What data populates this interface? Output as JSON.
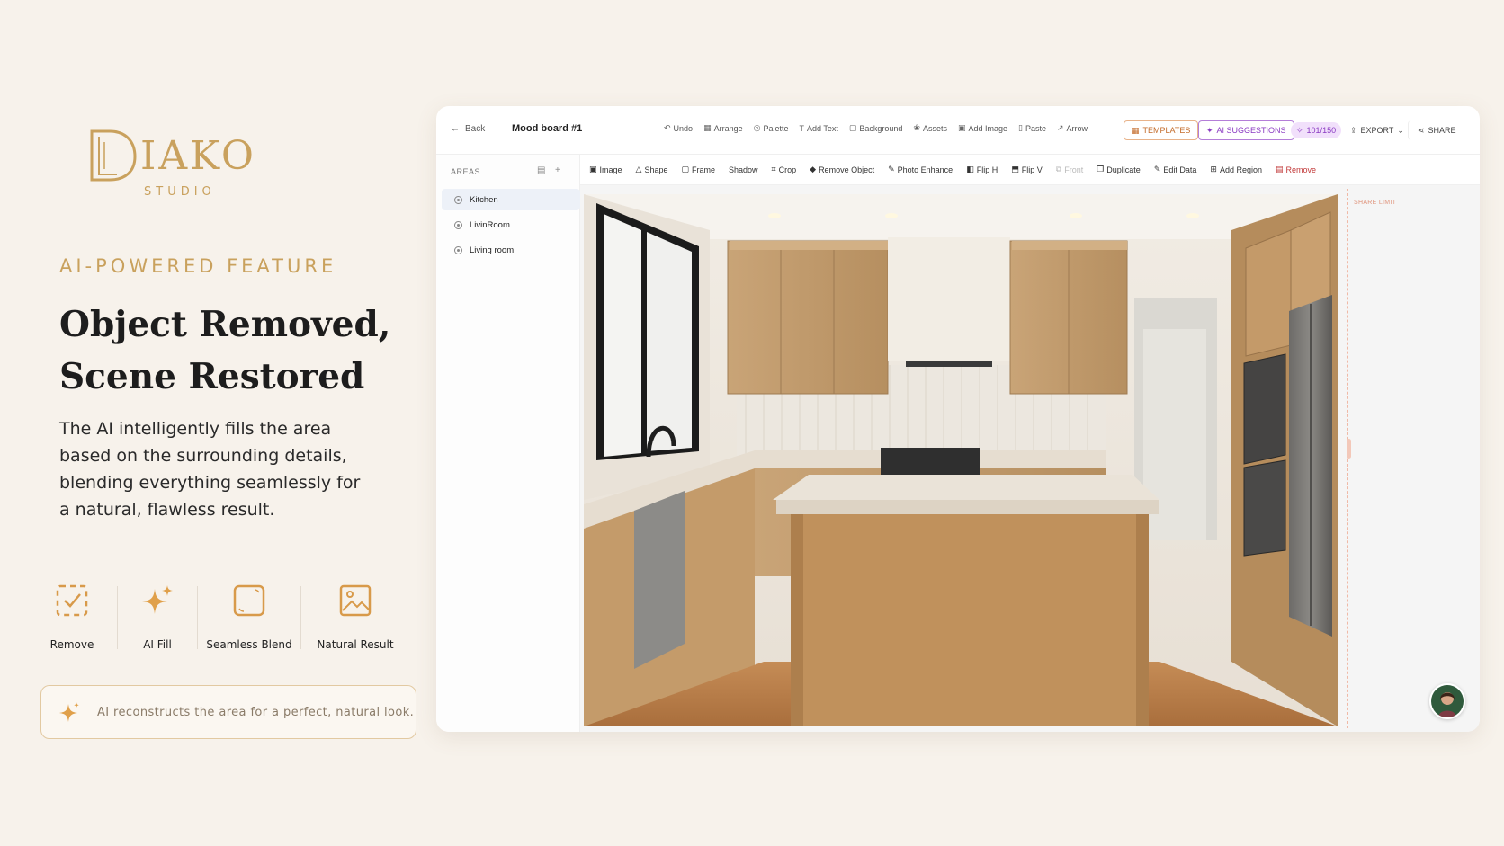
{
  "brand": {
    "name": "IAKO",
    "sub": "STUDIO",
    "accent": "#c9a15d"
  },
  "promo": {
    "tag": "AI-POWERED FEATURE",
    "headline_lines": [
      "Object Removed,",
      "Scene Restored"
    ],
    "description": "The AI intelligently fills the area based on the surrounding details, blending everything seamlessly for a natural, flawless result.",
    "features": [
      {
        "icon": "remove-check-icon",
        "label": "Remove"
      },
      {
        "icon": "sparkle-icon",
        "label": "AI Fill"
      },
      {
        "icon": "blend-square-icon",
        "label": "Seamless Blend"
      },
      {
        "icon": "image-icon",
        "label": "Natural Result"
      }
    ],
    "hint": "AI reconstructs the area for a perfect, natural look."
  },
  "app": {
    "back_label": "Back",
    "doc_title": "Mood board #1",
    "toolbar": [
      {
        "icon": "undo-icon",
        "label": "Undo"
      },
      {
        "icon": "arrange-icon",
        "label": "Arrange"
      },
      {
        "icon": "palette-icon",
        "label": "Palette"
      },
      {
        "icon": "text-icon",
        "label": "Add Text"
      },
      {
        "icon": "background-icon",
        "label": "Background"
      },
      {
        "icon": "assets-icon",
        "label": "Assets"
      },
      {
        "icon": "add-image-icon",
        "label": "Add Image"
      },
      {
        "icon": "paste-icon",
        "label": "Paste"
      },
      {
        "icon": "arrow-icon",
        "label": "Arrow"
      }
    ],
    "templates_label": "TEMPLATES",
    "ai_suggestions_label": "AI SUGGESTIONS",
    "credits": "101/150",
    "export_label": "EXPORT",
    "share_label": "SHARE",
    "areas_label": "AREAS",
    "areas": [
      {
        "label": "Kitchen",
        "selected": true
      },
      {
        "label": "LivinRoom",
        "selected": false
      },
      {
        "label": "Living room",
        "selected": false
      }
    ],
    "subtools": [
      {
        "icon": "image-icon",
        "label": "Image",
        "state": "normal"
      },
      {
        "icon": "shape-icon",
        "label": "Shape",
        "state": "normal"
      },
      {
        "icon": "frame-icon",
        "label": "Frame",
        "state": "normal"
      },
      {
        "icon": "shadow-icon",
        "label": "Shadow",
        "state": "normal"
      },
      {
        "icon": "crop-icon",
        "label": "Crop",
        "state": "normal"
      },
      {
        "icon": "eraser-icon",
        "label": "Remove Object",
        "state": "normal"
      },
      {
        "icon": "wand-icon",
        "label": "Photo Enhance",
        "state": "normal"
      },
      {
        "icon": "flip-h-icon",
        "label": "Flip H",
        "state": "normal"
      },
      {
        "icon": "flip-v-icon",
        "label": "Flip V",
        "state": "normal"
      },
      {
        "icon": "front-icon",
        "label": "Front",
        "state": "disabled"
      },
      {
        "icon": "duplicate-icon",
        "label": "Duplicate",
        "state": "normal"
      },
      {
        "icon": "edit-icon",
        "label": "Edit Data",
        "state": "normal"
      },
      {
        "icon": "add-region-icon",
        "label": "Add Region",
        "state": "normal"
      },
      {
        "icon": "trash-icon",
        "label": "Remove",
        "state": "danger"
      }
    ],
    "share_limit_label": "SHARE LIMIT"
  }
}
